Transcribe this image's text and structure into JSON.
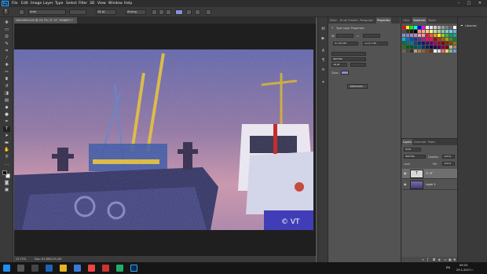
{
  "app": {
    "logo": "Ps",
    "menu": [
      "File",
      "Edit",
      "Image",
      "Layer",
      "Type",
      "Select",
      "Filter",
      "3D",
      "View",
      "Window",
      "Help"
    ],
    "window_controls": [
      "–",
      "□",
      "✕"
    ]
  },
  "options_bar": {
    "font_family": "Ariel",
    "font_size": "18 pt",
    "antialias": "Strong"
  },
  "document": {
    "tab_title": "DSC00924.tif @ 23,7% (© VT, RGB/8*) *"
  },
  "status": {
    "zoom": "23,72%",
    "doc_size": "Doc: 61,8M/119,2M"
  },
  "properties_panel": {
    "tabs": [
      "Mixer",
      "Brush Presets",
      "Paragraph",
      "Properties"
    ],
    "header": "Type Layer Properties",
    "font_size": "47,94 cm",
    "tracking": "12,47 cm",
    "style": "Normal",
    "leading": "18 pt",
    "color_label": "Color:",
    "advanced_button": "Advanced..."
  },
  "swatches_panel": {
    "tabs": [
      "Color",
      "Swatches",
      "Styles"
    ],
    "active_tab": "Swatches"
  },
  "libraries_panel": {
    "label": "Libraries"
  },
  "layers_panel": {
    "tabs": [
      "Layers",
      "Channels",
      "Paths"
    ],
    "kind_label": "Kind",
    "blend_mode": "Normal",
    "opacity_label": "Opacity:",
    "opacity_value": "100%",
    "lock_label": "Lock:",
    "fill_label": "Fill:",
    "fill_value": "100%",
    "layers": [
      {
        "name": "© VT",
        "type": "text",
        "selected": true
      },
      {
        "name": "Layer 1",
        "type": "image",
        "selected": false
      }
    ]
  },
  "taskbar": {
    "lang": "EN",
    "time": "09:53",
    "date": "29.1.2017 г."
  },
  "colors": {
    "accent": "#31a8ff",
    "text_color_swatch": "#8c8cd8",
    "swatches": [
      "#ff0000",
      "#ffff00",
      "#00ff00",
      "#00ffff",
      "#0000ff",
      "#ff00ff",
      "#ffffff",
      "#e6e6e6",
      "#cccccc",
      "#b3b3b3",
      "#999999",
      "#808080",
      "#666666",
      "#ffffff",
      "#4d4d4d",
      "#333333",
      "#1a1a1a",
      "#000000",
      "#f7977a",
      "#f9ad81",
      "#fdc68a",
      "#fff79a",
      "#c4df9b",
      "#a3d39c",
      "#82ca9d",
      "#7bcdc8",
      "#6ecff6",
      "#7ea7d8",
      "#8493ca",
      "#8882be",
      "#a187be",
      "#bc8dbf",
      "#f49ac2",
      "#f6989d",
      "#ed1c24",
      "#f26522",
      "#f7941d",
      "#fff200",
      "#8dc73f",
      "#39b54a",
      "#00a651",
      "#00a99d",
      "#00aeef",
      "#0072bc",
      "#0054a6",
      "#2e3192",
      "#662d91",
      "#92278f",
      "#ec008c",
      "#ed145b",
      "#9e0b0f",
      "#a0410d",
      "#a36209",
      "#aba000",
      "#598527",
      "#1a7b30",
      "#007236",
      "#00746b",
      "#0076a3",
      "#004b80",
      "#003471",
      "#1b1464",
      "#440e62",
      "#630460",
      "#9e005d",
      "#9e0039",
      "#790000",
      "#7b2e00",
      "#7d4900",
      "#827b00",
      "#406618",
      "#005e20",
      "#005826",
      "#005952",
      "#005b7f",
      "#003663",
      "#002157",
      "#0d004c",
      "#32004b",
      "#4b0049",
      "#7b0046",
      "#7a0026",
      "#c7b299",
      "#998675",
      "#736357",
      "#534741",
      "#37302a",
      "#c69c6e",
      "#a67c52",
      "#8c6239",
      "#754c24",
      "#603913",
      "#ffffff",
      "#d6d6d6",
      "#ff6666",
      "#ffcc66",
      "#66cc66",
      "#6699ff"
    ]
  }
}
